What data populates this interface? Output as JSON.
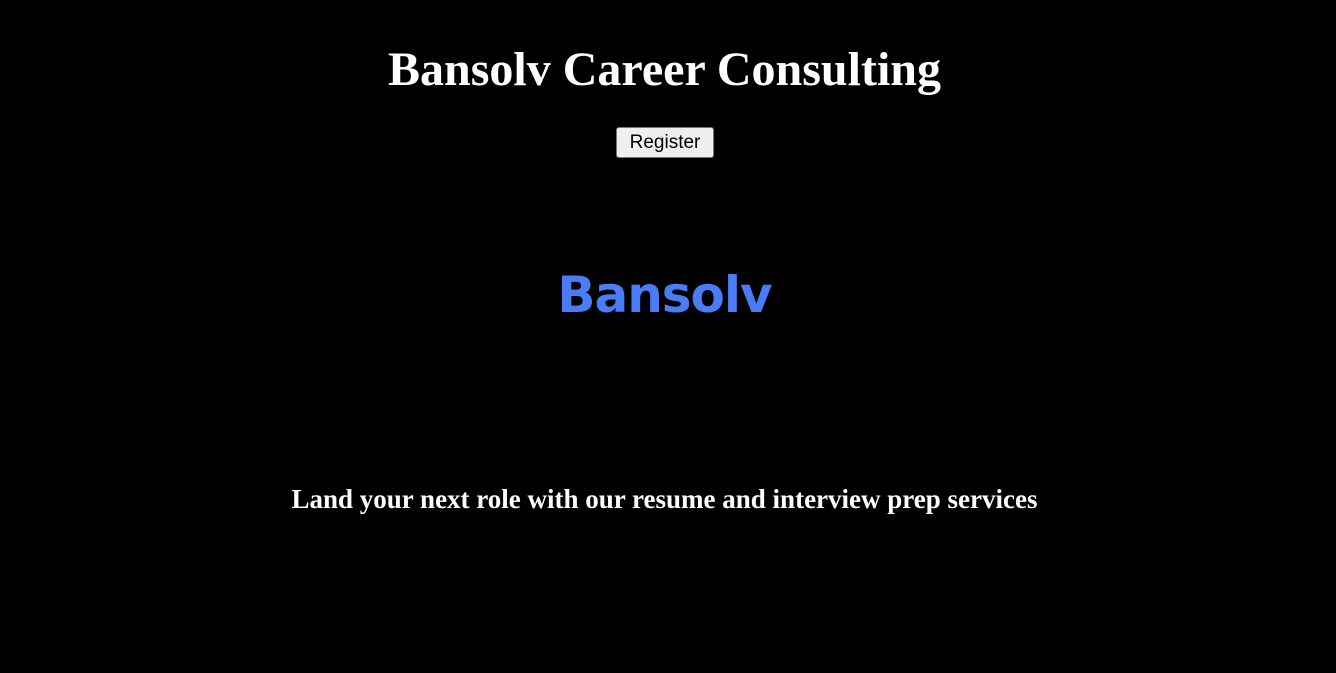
{
  "header": {
    "title": "Bansolv Career Consulting",
    "register_label": "Register"
  },
  "logo": {
    "text": "Bansolv",
    "color": "#4a7cf7"
  },
  "main": {
    "tagline": "Land your next role with our resume and interview prep services"
  },
  "colors": {
    "background": "#000000",
    "text": "#ffffff"
  }
}
